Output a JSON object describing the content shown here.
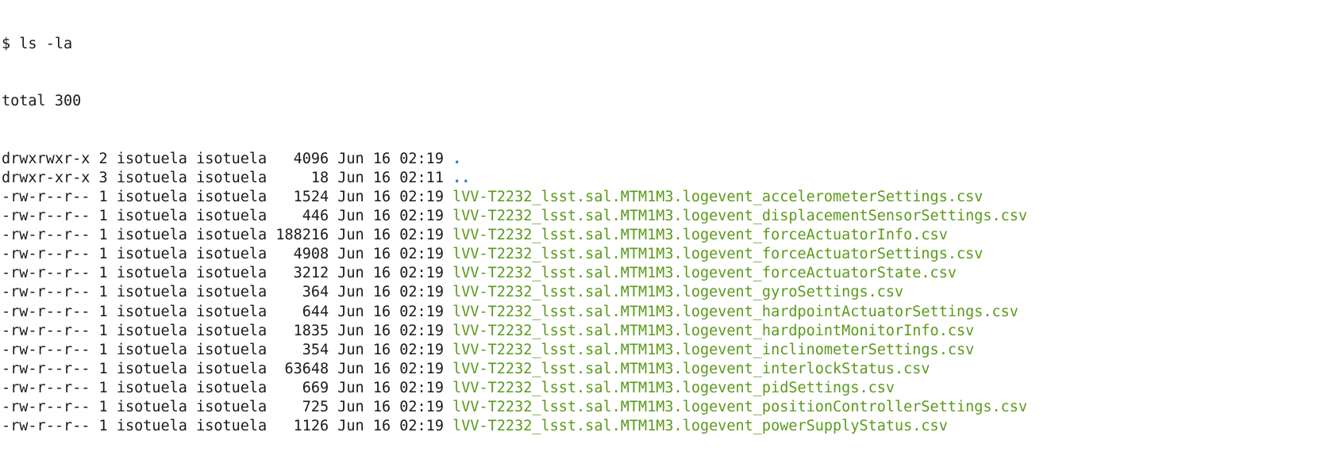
{
  "terminal": {
    "prompt": "$",
    "command": "ls -la",
    "total": "total 300",
    "colors": {
      "text": "#1a1a1a",
      "directory": "#2e7fb5",
      "file": "#5a9a1a"
    },
    "entries": [
      {
        "perm": "drwxrwxr-x",
        "links": "2",
        "owner": "isotuela",
        "group": "isotuela",
        "size": "4096",
        "month": "Jun",
        "day": "16",
        "time": "02:19",
        "name": ".",
        "type": "dir"
      },
      {
        "perm": "drwxr-xr-x",
        "links": "3",
        "owner": "isotuela",
        "group": "isotuela",
        "size": "18",
        "month": "Jun",
        "day": "16",
        "time": "02:11",
        "name": "..",
        "type": "dir"
      },
      {
        "perm": "-rw-r--r--",
        "links": "1",
        "owner": "isotuela",
        "group": "isotuela",
        "size": "1524",
        "month": "Jun",
        "day": "16",
        "time": "02:19",
        "name": "lVV-T2232_lsst.sal.MTM1M3.logevent_accelerometerSettings.csv",
        "type": "file"
      },
      {
        "perm": "-rw-r--r--",
        "links": "1",
        "owner": "isotuela",
        "group": "isotuela",
        "size": "446",
        "month": "Jun",
        "day": "16",
        "time": "02:19",
        "name": "lVV-T2232_lsst.sal.MTM1M3.logevent_displacementSensorSettings.csv",
        "type": "file"
      },
      {
        "perm": "-rw-r--r--",
        "links": "1",
        "owner": "isotuela",
        "group": "isotuela",
        "size": "188216",
        "month": "Jun",
        "day": "16",
        "time": "02:19",
        "name": "lVV-T2232_lsst.sal.MTM1M3.logevent_forceActuatorInfo.csv",
        "type": "file"
      },
      {
        "perm": "-rw-r--r--",
        "links": "1",
        "owner": "isotuela",
        "group": "isotuela",
        "size": "4908",
        "month": "Jun",
        "day": "16",
        "time": "02:19",
        "name": "lVV-T2232_lsst.sal.MTM1M3.logevent_forceActuatorSettings.csv",
        "type": "file"
      },
      {
        "perm": "-rw-r--r--",
        "links": "1",
        "owner": "isotuela",
        "group": "isotuela",
        "size": "3212",
        "month": "Jun",
        "day": "16",
        "time": "02:19",
        "name": "lVV-T2232_lsst.sal.MTM1M3.logevent_forceActuatorState.csv",
        "type": "file"
      },
      {
        "perm": "-rw-r--r--",
        "links": "1",
        "owner": "isotuela",
        "group": "isotuela",
        "size": "364",
        "month": "Jun",
        "day": "16",
        "time": "02:19",
        "name": "lVV-T2232_lsst.sal.MTM1M3.logevent_gyroSettings.csv",
        "type": "file"
      },
      {
        "perm": "-rw-r--r--",
        "links": "1",
        "owner": "isotuela",
        "group": "isotuela",
        "size": "644",
        "month": "Jun",
        "day": "16",
        "time": "02:19",
        "name": "lVV-T2232_lsst.sal.MTM1M3.logevent_hardpointActuatorSettings.csv",
        "type": "file"
      },
      {
        "perm": "-rw-r--r--",
        "links": "1",
        "owner": "isotuela",
        "group": "isotuela",
        "size": "1835",
        "month": "Jun",
        "day": "16",
        "time": "02:19",
        "name": "lVV-T2232_lsst.sal.MTM1M3.logevent_hardpointMonitorInfo.csv",
        "type": "file"
      },
      {
        "perm": "-rw-r--r--",
        "links": "1",
        "owner": "isotuela",
        "group": "isotuela",
        "size": "354",
        "month": "Jun",
        "day": "16",
        "time": "02:19",
        "name": "lVV-T2232_lsst.sal.MTM1M3.logevent_inclinometerSettings.csv",
        "type": "file"
      },
      {
        "perm": "-rw-r--r--",
        "links": "1",
        "owner": "isotuela",
        "group": "isotuela",
        "size": "63648",
        "month": "Jun",
        "day": "16",
        "time": "02:19",
        "name": "lVV-T2232_lsst.sal.MTM1M3.logevent_interlockStatus.csv",
        "type": "file"
      },
      {
        "perm": "-rw-r--r--",
        "links": "1",
        "owner": "isotuela",
        "group": "isotuela",
        "size": "669",
        "month": "Jun",
        "day": "16",
        "time": "02:19",
        "name": "lVV-T2232_lsst.sal.MTM1M3.logevent_pidSettings.csv",
        "type": "file"
      },
      {
        "perm": "-rw-r--r--",
        "links": "1",
        "owner": "isotuela",
        "group": "isotuela",
        "size": "725",
        "month": "Jun",
        "day": "16",
        "time": "02:19",
        "name": "lVV-T2232_lsst.sal.MTM1M3.logevent_positionControllerSettings.csv",
        "type": "file"
      },
      {
        "perm": "-rw-r--r--",
        "links": "1",
        "owner": "isotuela",
        "group": "isotuela",
        "size": "1126",
        "month": "Jun",
        "day": "16",
        "time": "02:19",
        "name": "lVV-T2232_lsst.sal.MTM1M3.logevent_powerSupplyStatus.csv",
        "type": "file"
      }
    ]
  }
}
